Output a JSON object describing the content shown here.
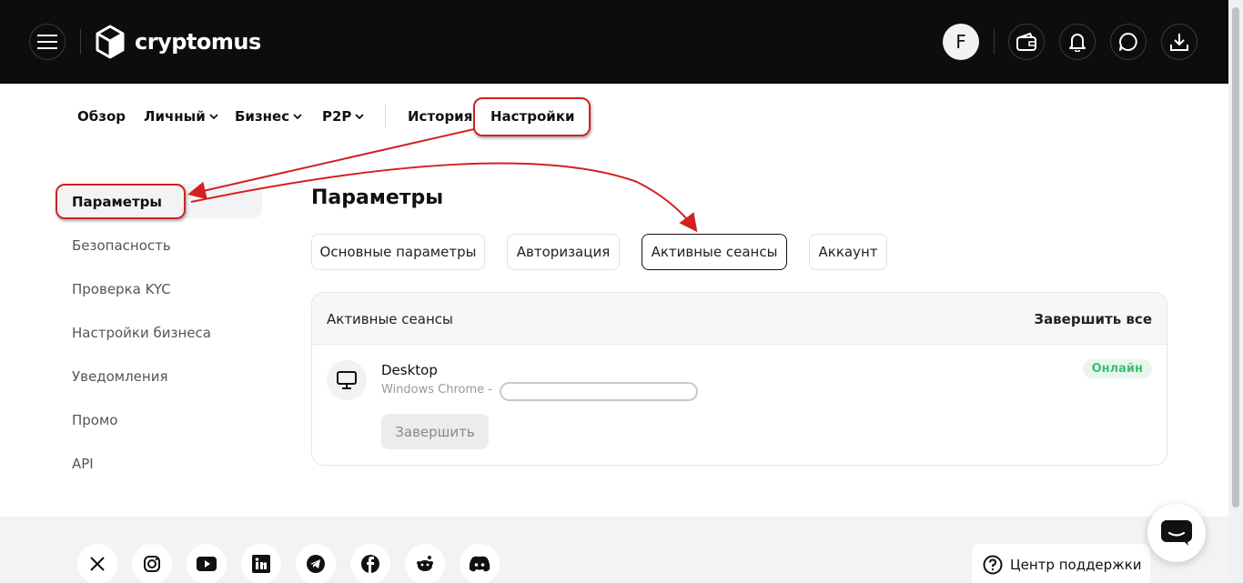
{
  "header": {
    "brand": "cryptomus",
    "avatar_letter": "F",
    "icons": [
      "menu-icon",
      "cube-logo-icon",
      "wallet-icon",
      "bell-icon",
      "chat-icon",
      "download-icon"
    ]
  },
  "nav": {
    "overview": "Обзор",
    "personal": "Личный",
    "business": "Бизнес",
    "p2p": "P2P",
    "history": "История",
    "settings": "Настройки"
  },
  "sidebar": {
    "items": [
      {
        "label": "Параметры"
      },
      {
        "label": "Безопасность"
      },
      {
        "label": "Проверка KYC"
      },
      {
        "label": "Настройки бизнеса"
      },
      {
        "label": "Уведомления"
      },
      {
        "label": "Промо"
      },
      {
        "label": "API"
      }
    ]
  },
  "main": {
    "title": "Параметры",
    "tabs": [
      {
        "label": "Основные параметры"
      },
      {
        "label": "Авторизация"
      },
      {
        "label": "Активные сеансы"
      },
      {
        "label": "Аккаунт"
      }
    ],
    "active_tab": "Активные сеансы",
    "sessions": {
      "header_title": "Активные сеансы",
      "end_all": "Завершить все",
      "device_name": "Desktop",
      "device_sub": "Windows Chrome -",
      "status": "Онлайн",
      "end_button": "Завершить"
    }
  },
  "footer": {
    "socials": [
      "x-icon",
      "instagram-icon",
      "youtube-icon",
      "linkedin-icon",
      "telegram-icon",
      "facebook-icon",
      "reddit-icon",
      "discord-icon"
    ],
    "support": "Центр поддержки"
  },
  "colors": {
    "topbar": "#0d0d0d",
    "annotation": "#d32020",
    "online": "#3fbf73"
  }
}
